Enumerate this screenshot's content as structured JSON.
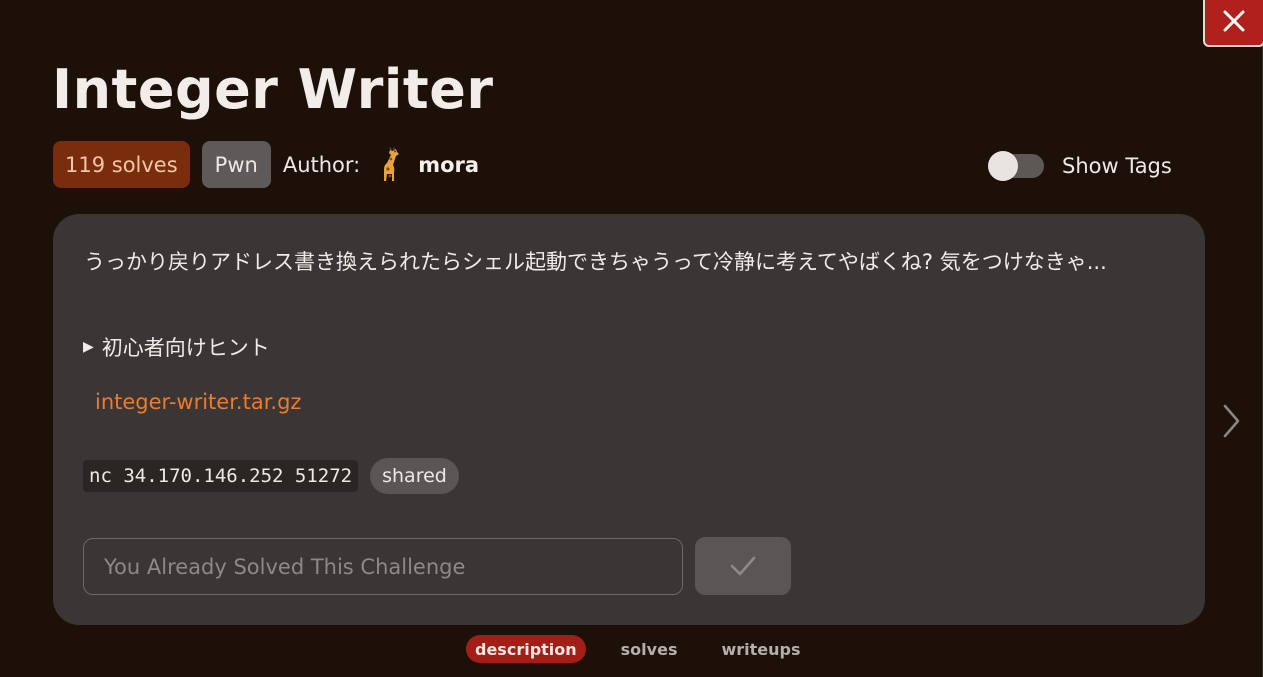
{
  "challenge": {
    "title": "Integer Writer",
    "solves": "119 solves",
    "category": "Pwn",
    "author_label": "Author:",
    "author_avatar": "giraffe-emoji",
    "author_name": "mora"
  },
  "tags_toggle": {
    "label": "Show Tags",
    "on": false
  },
  "card": {
    "description": "うっかり戻りアドレス書き換えられたらシェル起動できちゃうって冷静に考えてやばくね? 気をつけなきゃ...",
    "hint_arrow": "▶",
    "hint_label": "初心者向けヒント",
    "file_link": "integer-writer.tar.gz",
    "connection": "nc 34.170.146.252 51272",
    "instance_badge": "shared",
    "flag_placeholder": "You Already Solved This Challenge",
    "submit_icon": "check-icon"
  },
  "tabs": [
    {
      "label": "description",
      "active": true
    },
    {
      "label": "solves",
      "active": false
    },
    {
      "label": "writeups",
      "active": false
    }
  ],
  "colors": {
    "background": "#1c1009",
    "card": "#3a3635",
    "accent_orange": "#ef7a2a",
    "close_red": "#b0201c",
    "active_tab": "#a41e18"
  }
}
